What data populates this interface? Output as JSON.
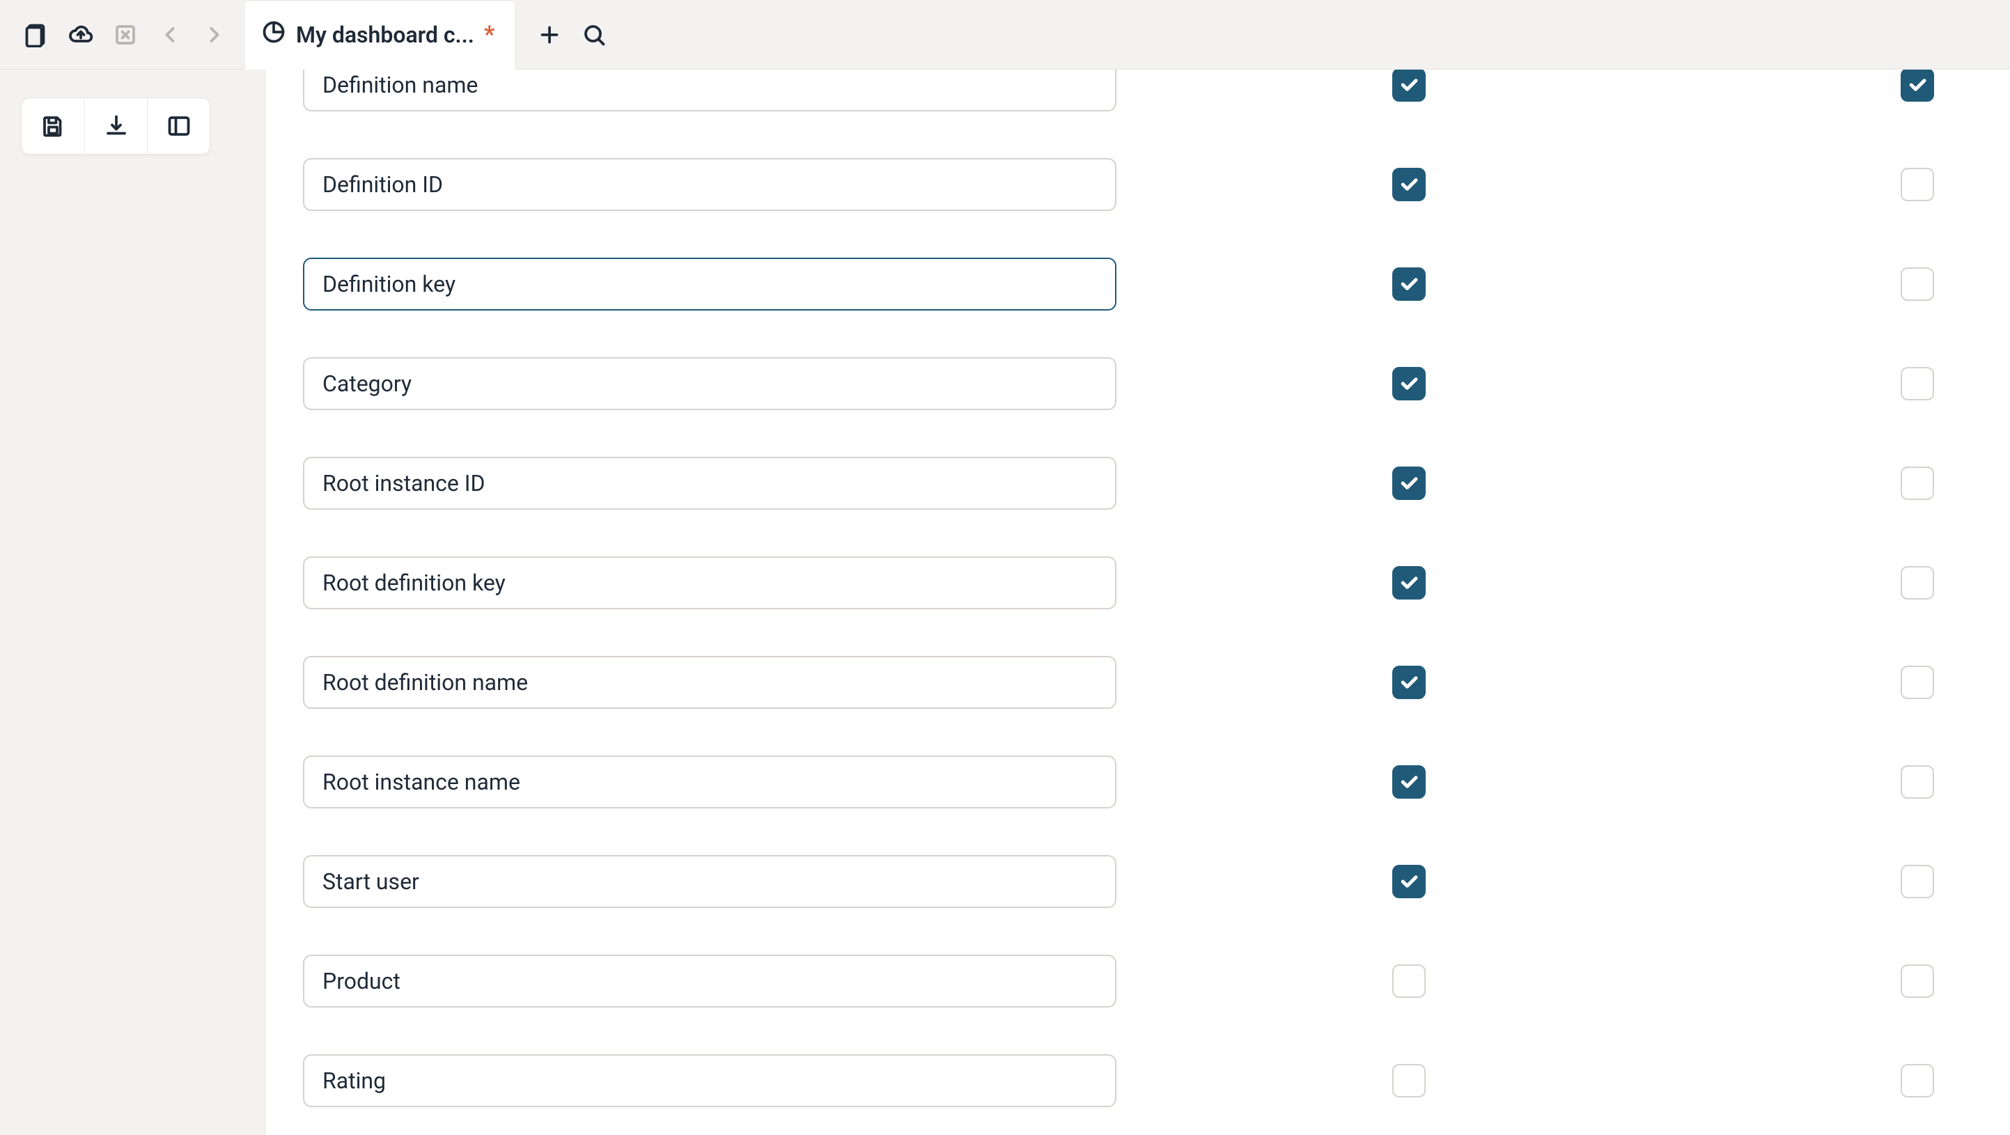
{
  "tab": {
    "title": "My dashboard c...",
    "dirty_indicator": "*"
  },
  "rows": [
    {
      "label": "Definition name",
      "col1": true,
      "col2": true,
      "selected": false,
      "top_partial": true
    },
    {
      "label": "Definition ID",
      "col1": true,
      "col2": false,
      "selected": false
    },
    {
      "label": "Definition key",
      "col1": true,
      "col2": false,
      "selected": true
    },
    {
      "label": "Category",
      "col1": true,
      "col2": false,
      "selected": false
    },
    {
      "label": "Root instance ID",
      "col1": true,
      "col2": false,
      "selected": false
    },
    {
      "label": "Root definition key",
      "col1": true,
      "col2": false,
      "selected": false
    },
    {
      "label": "Root definition name",
      "col1": true,
      "col2": false,
      "selected": false
    },
    {
      "label": "Root instance name",
      "col1": true,
      "col2": false,
      "selected": false
    },
    {
      "label": "Start user",
      "col1": true,
      "col2": false,
      "selected": false
    },
    {
      "label": "Product",
      "col1": false,
      "col2": false,
      "selected": false
    },
    {
      "label": "Rating",
      "col1": false,
      "col2": false,
      "selected": false
    }
  ],
  "colors": {
    "accent": "#205a78"
  }
}
